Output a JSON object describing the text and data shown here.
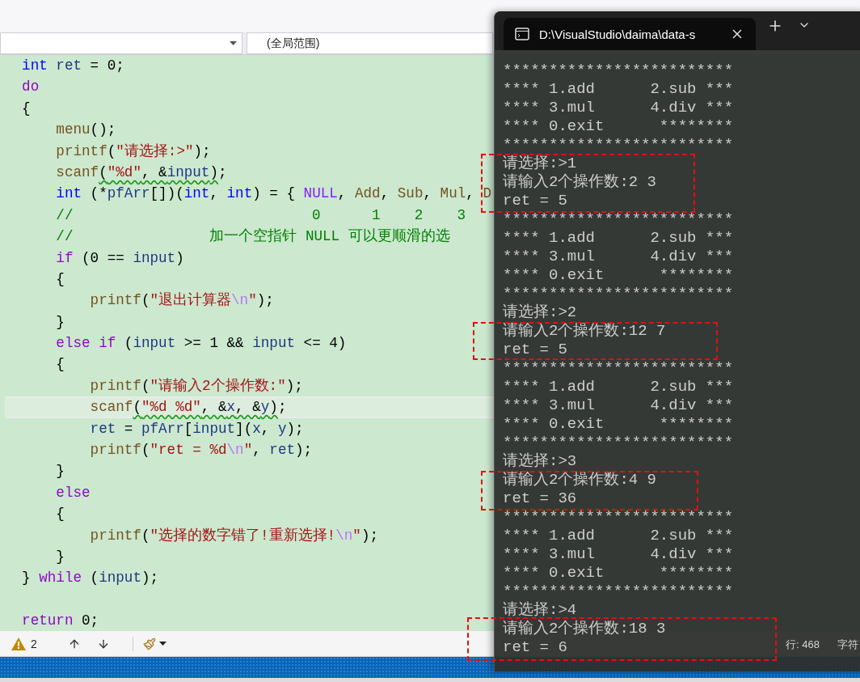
{
  "navigation": {
    "scope_dropdown": {
      "value": "(全局范围)"
    }
  },
  "code_lines": [
    {
      "kind": "code",
      "warning": false,
      "current": false,
      "tokens": [
        {
          "kind": "type",
          "text": "  int"
        },
        {
          "kind": "ident",
          "text": " ret"
        },
        {
          "kind": "plain",
          "text": " = "
        },
        {
          "kind": "number",
          "text": "0"
        },
        {
          "kind": "plain",
          "text": ";"
        }
      ]
    },
    {
      "kind": "code",
      "warning": false,
      "current": false,
      "tokens": [
        {
          "kind": "control",
          "text": "  do"
        }
      ]
    },
    {
      "kind": "code",
      "warning": false,
      "current": false,
      "tokens": [
        {
          "kind": "plain",
          "text": "  {"
        }
      ]
    },
    {
      "kind": "code",
      "warning": false,
      "current": false,
      "tokens": [
        {
          "kind": "function",
          "text": "      menu"
        },
        {
          "kind": "plain",
          "text": "();"
        }
      ]
    },
    {
      "kind": "code",
      "warning": false,
      "current": false,
      "tokens": [
        {
          "kind": "function",
          "text": "      printf"
        },
        {
          "kind": "plain",
          "text": "("
        },
        {
          "kind": "string",
          "text": "\"请选择:>\""
        },
        {
          "kind": "plain",
          "text": ");"
        }
      ]
    },
    {
      "kind": "code",
      "warning": true,
      "current": false,
      "tokens": [
        {
          "kind": "function",
          "text": "      scanf"
        },
        {
          "kind": "plain",
          "text": "("
        },
        {
          "kind": "string",
          "text": "\"%d\""
        },
        {
          "kind": "plain",
          "text": ", &"
        },
        {
          "kind": "ident",
          "text": "input"
        },
        {
          "kind": "plain",
          "text": ")"
        },
        {
          "kind": "plain",
          "text": ";"
        }
      ]
    },
    {
      "kind": "code",
      "warning": false,
      "current": false,
      "tokens": [
        {
          "kind": "type",
          "text": "      int"
        },
        {
          "kind": "plain",
          "text": " (*"
        },
        {
          "kind": "ident",
          "text": "pfArr"
        },
        {
          "kind": "plain",
          "text": "[])("
        },
        {
          "kind": "type",
          "text": "int"
        },
        {
          "kind": "plain",
          "text": ", "
        },
        {
          "kind": "type",
          "text": "int"
        },
        {
          "kind": "plain",
          "text": ") = { "
        },
        {
          "kind": "macro",
          "text": "NULL"
        },
        {
          "kind": "plain",
          "text": ", "
        },
        {
          "kind": "function",
          "text": "Add"
        },
        {
          "kind": "plain",
          "text": ", "
        },
        {
          "kind": "function",
          "text": "Sub"
        },
        {
          "kind": "plain",
          "text": ", "
        },
        {
          "kind": "function",
          "text": "Mul"
        },
        {
          "kind": "plain",
          "text": ", "
        },
        {
          "kind": "function",
          "text": "D"
        }
      ]
    },
    {
      "kind": "code",
      "warning": false,
      "current": false,
      "tokens": [
        {
          "kind": "comment",
          "text": "      //                            0      1    2    3"
        }
      ]
    },
    {
      "kind": "code",
      "warning": false,
      "current": false,
      "tokens": [
        {
          "kind": "comment",
          "text": "      //                加一个空指针 NULL 可以更顺滑的选"
        }
      ]
    },
    {
      "kind": "code",
      "warning": false,
      "current": false,
      "tokens": [
        {
          "kind": "control",
          "text": "      if"
        },
        {
          "kind": "plain",
          "text": " ("
        },
        {
          "kind": "number",
          "text": "0"
        },
        {
          "kind": "plain",
          "text": " == "
        },
        {
          "kind": "ident",
          "text": "input"
        },
        {
          "kind": "plain",
          "text": ")"
        }
      ]
    },
    {
      "kind": "code",
      "warning": false,
      "current": false,
      "tokens": [
        {
          "kind": "plain",
          "text": "      {"
        }
      ]
    },
    {
      "kind": "code",
      "warning": false,
      "current": false,
      "tokens": [
        {
          "kind": "function",
          "text": "          printf"
        },
        {
          "kind": "plain",
          "text": "("
        },
        {
          "kind": "string",
          "text": "\"退出计算器"
        },
        {
          "kind": "escape",
          "text": "\\n"
        },
        {
          "kind": "string",
          "text": "\""
        },
        {
          "kind": "plain",
          "text": ");"
        }
      ]
    },
    {
      "kind": "code",
      "warning": false,
      "current": false,
      "tokens": [
        {
          "kind": "plain",
          "text": "      }"
        }
      ]
    },
    {
      "kind": "code",
      "warning": false,
      "current": false,
      "tokens": [
        {
          "kind": "control",
          "text": "      else"
        },
        {
          "kind": "control",
          "text": " if"
        },
        {
          "kind": "plain",
          "text": " ("
        },
        {
          "kind": "ident",
          "text": "input"
        },
        {
          "kind": "plain",
          "text": " >= "
        },
        {
          "kind": "number",
          "text": "1"
        },
        {
          "kind": "plain",
          "text": " && "
        },
        {
          "kind": "ident",
          "text": "input"
        },
        {
          "kind": "plain",
          "text": " <= "
        },
        {
          "kind": "number",
          "text": "4"
        },
        {
          "kind": "plain",
          "text": ")"
        }
      ]
    },
    {
      "kind": "code",
      "warning": false,
      "current": false,
      "tokens": [
        {
          "kind": "plain",
          "text": "      {"
        }
      ]
    },
    {
      "kind": "code",
      "warning": false,
      "current": false,
      "tokens": [
        {
          "kind": "function",
          "text": "          printf"
        },
        {
          "kind": "plain",
          "text": "("
        },
        {
          "kind": "string",
          "text": "\"请输入2个操作数:\""
        },
        {
          "kind": "plain",
          "text": ");"
        }
      ]
    },
    {
      "kind": "code",
      "warning": true,
      "current": true,
      "tokens": [
        {
          "kind": "function",
          "text": "          scanf"
        },
        {
          "kind": "plain",
          "text": "("
        },
        {
          "kind": "string",
          "text": "\"%d %d\""
        },
        {
          "kind": "plain",
          "text": ", &"
        },
        {
          "kind": "ident",
          "text": "x"
        },
        {
          "kind": "plain",
          "text": ", &"
        },
        {
          "kind": "ident",
          "text": "y"
        },
        {
          "kind": "plain",
          "text": ")"
        },
        {
          "kind": "plain",
          "text": ";"
        }
      ]
    },
    {
      "kind": "code",
      "warning": false,
      "current": false,
      "tokens": [
        {
          "kind": "ident",
          "text": "          ret"
        },
        {
          "kind": "plain",
          "text": " = "
        },
        {
          "kind": "ident",
          "text": "pfArr"
        },
        {
          "kind": "plain",
          "text": "["
        },
        {
          "kind": "ident",
          "text": "input"
        },
        {
          "kind": "plain",
          "text": "]("
        },
        {
          "kind": "ident",
          "text": "x"
        },
        {
          "kind": "plain",
          "text": ", "
        },
        {
          "kind": "ident",
          "text": "y"
        },
        {
          "kind": "plain",
          "text": ");"
        }
      ]
    },
    {
      "kind": "code",
      "warning": false,
      "current": false,
      "tokens": [
        {
          "kind": "function",
          "text": "          printf"
        },
        {
          "kind": "plain",
          "text": "("
        },
        {
          "kind": "string",
          "text": "\"ret = %d"
        },
        {
          "kind": "escape",
          "text": "\\n"
        },
        {
          "kind": "string",
          "text": "\""
        },
        {
          "kind": "plain",
          "text": ", "
        },
        {
          "kind": "ident",
          "text": "ret"
        },
        {
          "kind": "plain",
          "text": ");"
        }
      ]
    },
    {
      "kind": "code",
      "warning": false,
      "current": false,
      "tokens": [
        {
          "kind": "plain",
          "text": "      }"
        }
      ]
    },
    {
      "kind": "code",
      "warning": false,
      "current": false,
      "tokens": [
        {
          "kind": "control",
          "text": "      else"
        }
      ]
    },
    {
      "kind": "code",
      "warning": false,
      "current": false,
      "tokens": [
        {
          "kind": "plain",
          "text": "      {"
        }
      ]
    },
    {
      "kind": "code",
      "warning": false,
      "current": false,
      "tokens": [
        {
          "kind": "function",
          "text": "          printf"
        },
        {
          "kind": "plain",
          "text": "("
        },
        {
          "kind": "string",
          "text": "\"选择的数字错了!重新选择!"
        },
        {
          "kind": "escape",
          "text": "\\n"
        },
        {
          "kind": "string",
          "text": "\""
        },
        {
          "kind": "plain",
          "text": ");"
        }
      ]
    },
    {
      "kind": "code",
      "warning": false,
      "current": false,
      "tokens": [
        {
          "kind": "plain",
          "text": "      }"
        }
      ]
    },
    {
      "kind": "code",
      "warning": false,
      "current": false,
      "tokens": [
        {
          "kind": "plain",
          "text": "  }"
        },
        {
          "kind": "control",
          "text": " while"
        },
        {
          "kind": "plain",
          "text": " ("
        },
        {
          "kind": "ident",
          "text": "input"
        },
        {
          "kind": "plain",
          "text": ");"
        }
      ]
    },
    {
      "kind": "blank"
    },
    {
      "kind": "code",
      "warning": false,
      "current": false,
      "tokens": [
        {
          "kind": "control",
          "text": "  return"
        },
        {
          "kind": "number",
          "text": " 0"
        },
        {
          "kind": "plain",
          "text": ";"
        }
      ]
    }
  ],
  "editor_toolbar": {
    "warnings": "2",
    "line_position": "行: 468",
    "column_position": "字符"
  },
  "terminal": {
    "tab_title": "D:\\VisualStudio\\daima\\data-s",
    "lines": [
      "*************************",
      "**** 1.add      2.sub ***",
      "**** 3.mul      4.div ***",
      "**** 0.exit      ********",
      "*************************",
      "请选择:>1",
      "请输入2个操作数:2 3",
      "ret = 5",
      "*************************",
      "**** 1.add      2.sub ***",
      "**** 3.mul      4.div ***",
      "**** 0.exit      ********",
      "*************************",
      "请选择:>2",
      "请输入2个操作数:12 7",
      "ret = 5",
      "*************************",
      "**** 1.add      2.sub ***",
      "**** 3.mul      4.div ***",
      "**** 0.exit      ********",
      "*************************",
      "请选择:>3",
      "请输入2个操作数:4 9",
      "ret = 36",
      "*************************",
      "**** 1.add      2.sub ***",
      "**** 3.mul      4.div ***",
      "**** 0.exit      ********",
      "*************************",
      "请选择:>4",
      "请输入2个操作数:18 3",
      "ret = 6"
    ]
  }
}
